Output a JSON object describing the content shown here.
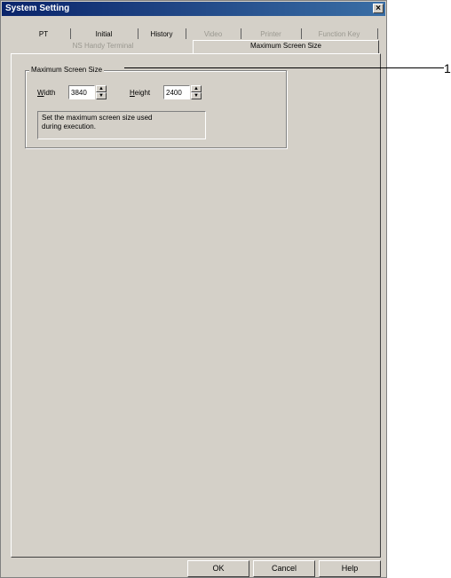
{
  "window": {
    "title": "System Setting",
    "close_glyph": "×"
  },
  "tabs": {
    "row1": [
      {
        "label": "PT",
        "enabled": true
      },
      {
        "label": "Initial",
        "enabled": true
      },
      {
        "label": "History",
        "enabled": true
      },
      {
        "label": "Video",
        "enabled": false
      },
      {
        "label": "Printer",
        "enabled": false
      },
      {
        "label": "Function Key",
        "enabled": false
      }
    ],
    "row2": [
      {
        "label": "NS Handy Terminal",
        "enabled": false
      },
      {
        "label": "Maximum Screen Size",
        "enabled": true,
        "selected": true
      }
    ]
  },
  "group": {
    "title": "Maximum Screen Size",
    "width_label_accel": "W",
    "width_label_rest": "idth",
    "width_value": "3840",
    "height_label_accel": "H",
    "height_label_rest": "eight",
    "height_value": "2400",
    "description_line1": "Set the maximum screen size used",
    "description_line2": "during execution."
  },
  "buttons": {
    "ok": "OK",
    "cancel": "Cancel",
    "help": "Help"
  },
  "callout": {
    "number": "1"
  }
}
